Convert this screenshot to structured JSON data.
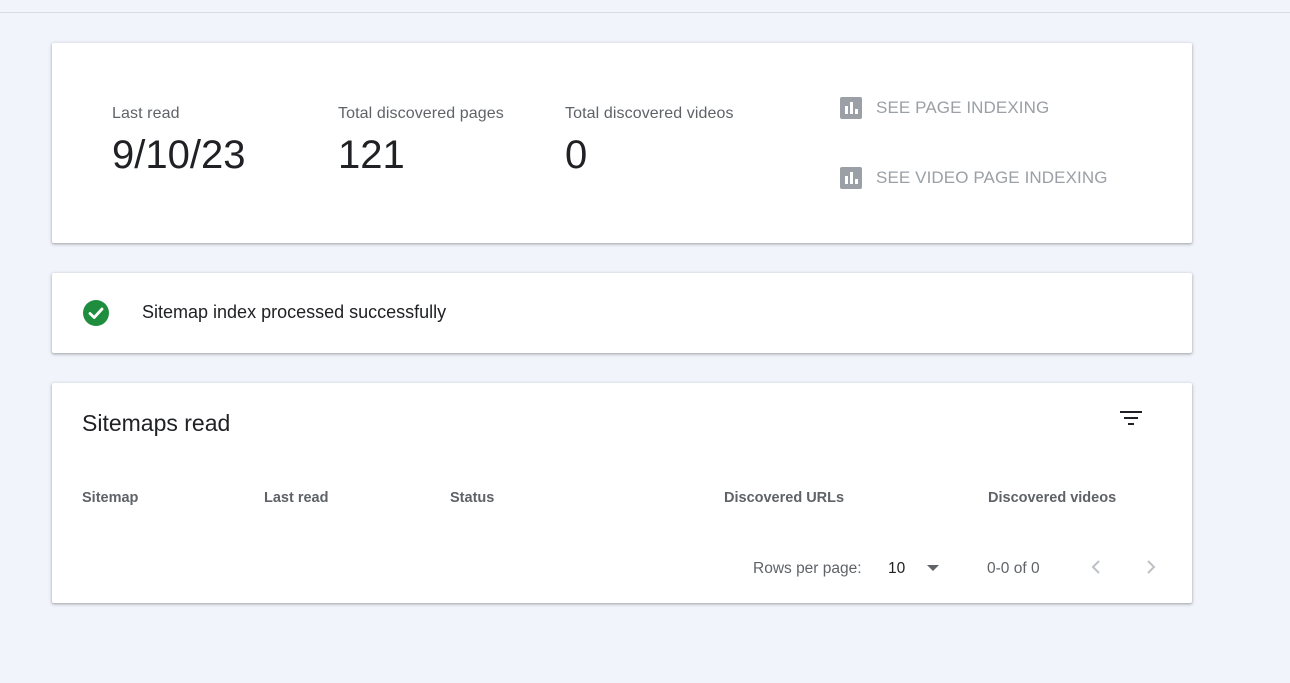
{
  "stats": {
    "last_read_label": "Last read",
    "last_read_value": "9/10/23",
    "pages_label": "Total discovered pages",
    "pages_value": "121",
    "videos_label": "Total discovered videos",
    "videos_value": "0",
    "see_page_indexing": "SEE PAGE INDEXING",
    "see_video_page_indexing": "SEE VIDEO PAGE INDEXING",
    "link_icon": "bar-chart-icon"
  },
  "status": {
    "icon": "check-circle-icon",
    "text": "Sitemap index processed successfully",
    "color": "#1e8e3e"
  },
  "sitemaps": {
    "title": "Sitemaps read",
    "filter_icon": "filter-icon",
    "columns": [
      "Sitemap",
      "Last read",
      "Status",
      "Discovered URLs",
      "Discovered videos"
    ],
    "rows": [],
    "rows_per_page_label": "Rows per page:",
    "rows_per_page_value": "10",
    "range_text": "0-0 of 0",
    "prev_icon": "chevron-left-icon",
    "next_icon": "chevron-right-icon"
  }
}
